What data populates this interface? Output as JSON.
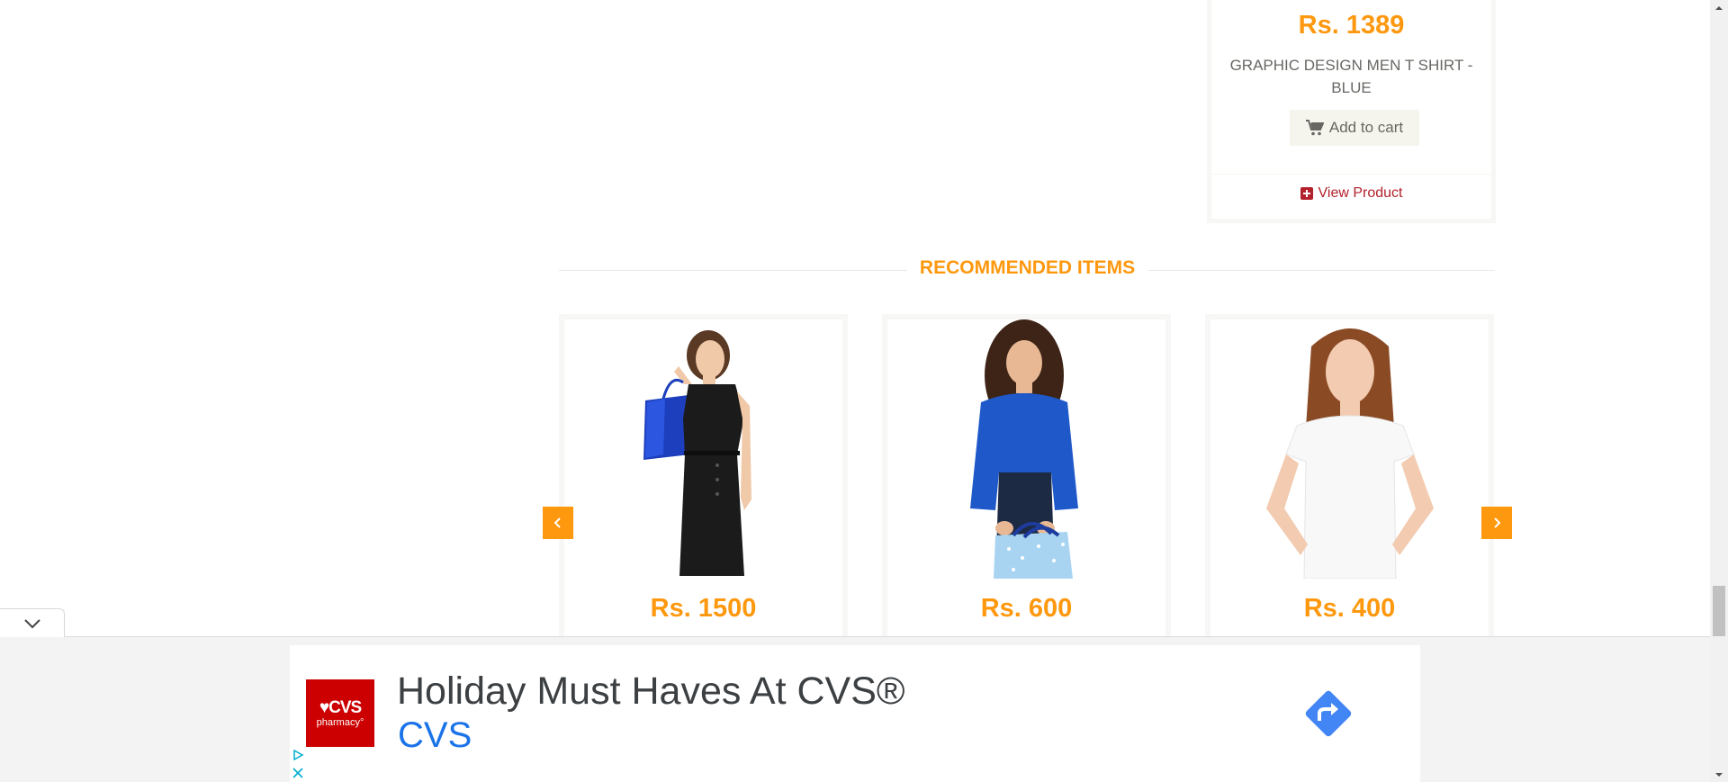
{
  "top_product": {
    "price": "Rs. 1389",
    "title": "GRAPHIC DESIGN MEN T SHIRT - BLUE",
    "add_to_cart": "Add to cart",
    "view_product": "View Product"
  },
  "recommended": {
    "heading": "RECOMMENDED ITEMS",
    "items": [
      {
        "price": "Rs. 1500",
        "image": "woman-black-dress-blue-bag"
      },
      {
        "price": "Rs. 600",
        "image": "woman-blue-top-shopping-bag"
      },
      {
        "price": "Rs. 400",
        "image": "girl-white-tshirt"
      }
    ],
    "prev_icon": "chevron-left-icon",
    "next_icon": "chevron-right-icon"
  },
  "ad": {
    "logo_line1": "♥CVS",
    "logo_line2": "pharmacy°",
    "headline": "Holiday Must Haves At CVS®",
    "brand": "CVS",
    "go_icon": "directions-arrow-icon",
    "collapse_icon": "chevron-down-icon"
  },
  "colors": {
    "accent": "#fe980f",
    "link": "#b3212c",
    "ad_brand": "#1a73e8",
    "cvs_red": "#cc0000"
  }
}
